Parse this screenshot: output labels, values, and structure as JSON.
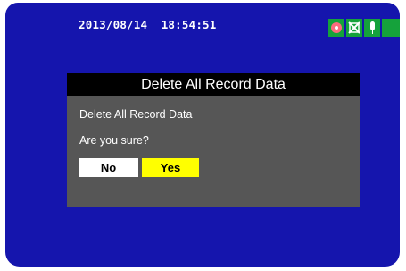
{
  "status_bar": {
    "datetime": "2013/08/14  18:54:51",
    "icons": [
      "record-icon",
      "no-card-icon",
      "microphone-icon",
      "battery-icon"
    ],
    "icon_color": "#15a23b"
  },
  "dialog": {
    "title": "Delete All Record Data",
    "message": "Delete All Record Data",
    "question": "Are you sure?",
    "no_label": "No",
    "yes_label": "Yes",
    "selected": "Yes"
  },
  "colors": {
    "screen_background": "#1515ad",
    "dialog_background": "#565656",
    "dialog_title_background": "#000000",
    "selected_button": "#ffff00",
    "unselected_button": "#ffffff"
  }
}
